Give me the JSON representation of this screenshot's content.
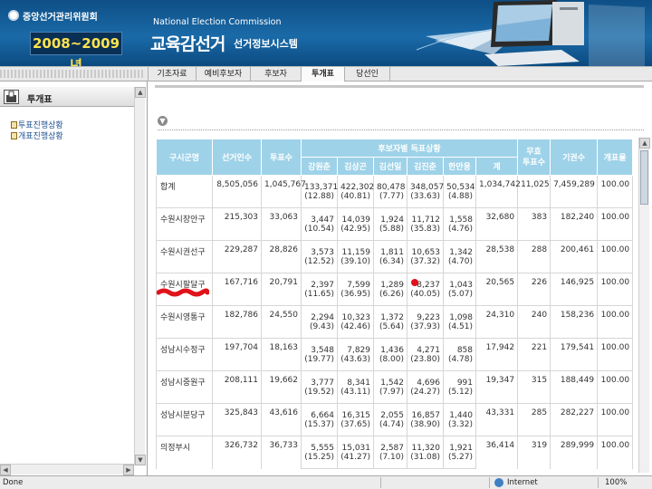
{
  "header": {
    "org_name": "중앙선거관리위원회",
    "year_range": "2008~2009년",
    "nec_english": "National Election Commission",
    "system_title": "교육감선거",
    "system_subtitle": "선거정보시스템"
  },
  "nav": {
    "tabs": [
      "기초자료",
      "예비후보자",
      "후보자",
      "투개표",
      "당선인"
    ],
    "active": "투개표"
  },
  "sidebar": {
    "title": "투개표",
    "links": [
      "투표진행상황",
      "개표진행상황"
    ]
  },
  "table": {
    "headers": {
      "region": "구시군명",
      "electorate": "선거인수",
      "voters": "투표수",
      "candidates_group": "후보자별 득표상황",
      "candidates": [
        "강원춘",
        "김상곤",
        "김선일",
        "김진춘",
        "한만용"
      ],
      "sum": "계",
      "invalid": "무효\n투표수",
      "abstain": "기권수",
      "progress": "개표율"
    },
    "rows": [
      {
        "name": "합계",
        "electorate": "8,505,056",
        "voters": "1,045,767",
        "votes": [
          "133,371",
          "422,302",
          "80,478",
          "348,057",
          "50,534"
        ],
        "pcts": [
          "(12.88)",
          "(40.81)",
          "(7.77)",
          "(33.63)",
          "(4.88)"
        ],
        "sum": "1,034,742",
        "invalid": "11,025",
        "abstain": "7,459,289",
        "progress": "100.00"
      },
      {
        "name": "수원시장안구",
        "electorate": "215,303",
        "voters": "33,063",
        "votes": [
          "3,447",
          "14,039",
          "1,924",
          "11,712",
          "1,558"
        ],
        "pcts": [
          "(10.54)",
          "(42.95)",
          "(5.88)",
          "(35.83)",
          "(4.76)"
        ],
        "sum": "32,680",
        "invalid": "383",
        "abstain": "182,240",
        "progress": "100.00"
      },
      {
        "name": "수원시권선구",
        "electorate": "229,287",
        "voters": "28,826",
        "votes": [
          "3,573",
          "11,159",
          "1,811",
          "10,653",
          "1,342"
        ],
        "pcts": [
          "(12.52)",
          "(39.10)",
          "(6.34)",
          "(37.32)",
          "(4.70)"
        ],
        "sum": "28,538",
        "invalid": "288",
        "abstain": "200,461",
        "progress": "100.00"
      },
      {
        "name": "수원시팔달구",
        "electorate": "167,716",
        "voters": "20,791",
        "votes": [
          "2,397",
          "7,599",
          "1,289",
          "8,237",
          "1,043"
        ],
        "pcts": [
          "(11.65)",
          "(36.95)",
          "(6.26)",
          "(40.05)",
          "(5.07)"
        ],
        "sum": "20,565",
        "invalid": "226",
        "abstain": "146,925",
        "progress": "100.00"
      },
      {
        "name": "수원시영통구",
        "electorate": "182,786",
        "voters": "24,550",
        "votes": [
          "2,294",
          "10,323",
          "1,372",
          "9,223",
          "1,098"
        ],
        "pcts": [
          "(9.43)",
          "(42.46)",
          "(5.64)",
          "(37.93)",
          "(4.51)"
        ],
        "sum": "24,310",
        "invalid": "240",
        "abstain": "158,236",
        "progress": "100.00"
      },
      {
        "name": "성남시수정구",
        "electorate": "197,704",
        "voters": "18,163",
        "votes": [
          "3,548",
          "7,829",
          "1,436",
          "4,271",
          "858"
        ],
        "pcts": [
          "(19.77)",
          "(43.63)",
          "(8.00)",
          "(23.80)",
          "(4.78)"
        ],
        "sum": "17,942",
        "invalid": "221",
        "abstain": "179,541",
        "progress": "100.00"
      },
      {
        "name": "성남시중원구",
        "electorate": "208,111",
        "voters": "19,662",
        "votes": [
          "3,777",
          "8,341",
          "1,542",
          "4,696",
          "991"
        ],
        "pcts": [
          "(19.52)",
          "(43.11)",
          "(7.97)",
          "(24.27)",
          "(5.12)"
        ],
        "sum": "19,347",
        "invalid": "315",
        "abstain": "188,449",
        "progress": "100.00"
      },
      {
        "name": "성남시분당구",
        "electorate": "325,843",
        "voters": "43,616",
        "votes": [
          "6,664",
          "16,315",
          "2,055",
          "16,857",
          "1,440"
        ],
        "pcts": [
          "(15.37)",
          "(37.65)",
          "(4.74)",
          "(38.90)",
          "(3.32)"
        ],
        "sum": "43,331",
        "invalid": "285",
        "abstain": "282,227",
        "progress": "100.00"
      },
      {
        "name": "의정부시",
        "electorate": "326,732",
        "voters": "36,733",
        "votes": [
          "5,555",
          "15,031",
          "2,587",
          "11,320",
          "1,921"
        ],
        "pcts": [
          "(15.25)",
          "(41.27)",
          "(7.10)",
          "(31.08)",
          "(5.27)"
        ],
        "sum": "36,414",
        "invalid": "319",
        "abstain": "289,999",
        "progress": "100.00"
      }
    ]
  },
  "statusbar": {
    "status": "Done",
    "zone": "Internet",
    "zoom": "100%"
  },
  "colors": {
    "header_blue": "#1a6aa8",
    "table_header": "#9ed2e8",
    "year_text": "#ffe34d"
  },
  "icons": [
    "logo-icon",
    "ballot-box-icon",
    "folder-icon",
    "down-arrow-icon",
    "globe-icon",
    "monitor-illustration"
  ]
}
